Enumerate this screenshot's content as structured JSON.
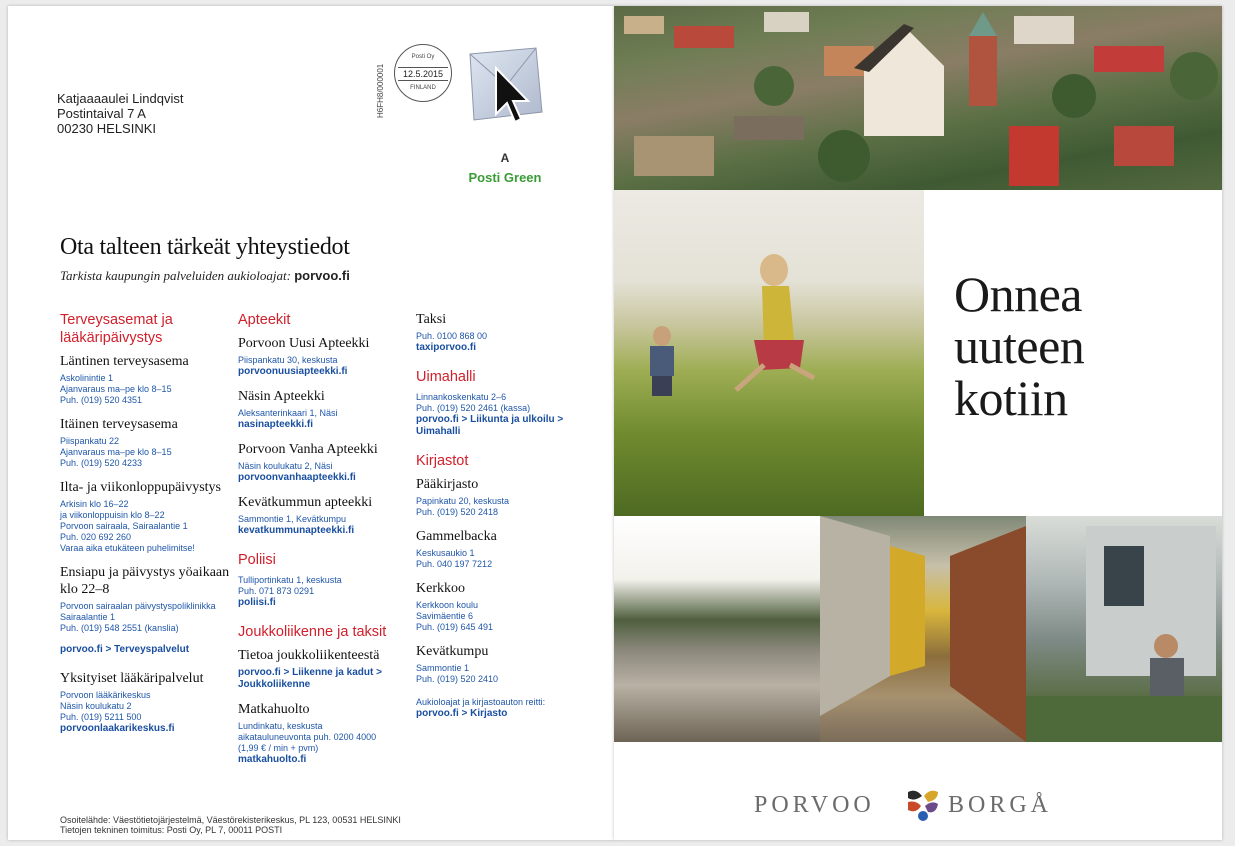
{
  "address": {
    "name": "Katjaaaaulei Lindqvist",
    "street": "Postintaival 7 A",
    "city": "00230 HELSINKI"
  },
  "postage": {
    "code": "H6FH8/000001",
    "postmark_top": "Posti Oy",
    "postmark_date": "12.5.2015",
    "postmark_bottom": "FINLAND",
    "class": "A",
    "service": "Posti Green"
  },
  "heading": {
    "title": "Ota talteen tärkeät yhteystiedot",
    "subtitle_prefix": "Tarkista kaupungin palveluiden aukioloajat:",
    "subtitle_link": "porvoo.fi"
  },
  "col1": {
    "section1": {
      "title": "Terveysasemat ja lääkäripäivystys",
      "entries": [
        {
          "name": "Läntinen terveysasema",
          "lines": [
            "Askolinintie 1",
            "Ajanvaraus ma–pe klo 8–15",
            "Puh. (019) 520 4351"
          ]
        },
        {
          "name": "Itäinen terveysasema",
          "lines": [
            "Piispankatu 22",
            "Ajanvaraus ma–pe klo 8–15",
            "Puh. (019) 520 4233"
          ]
        },
        {
          "name": "Ilta- ja viikonloppupäivystys",
          "lines": [
            "Arkisin klo 16–22",
            "ja viikonloppuisin klo 8–22",
            "Porvoon sairaala, Sairaalantie 1",
            "Puh. 020 692 260",
            "Varaa aika etukäteen puhelimitse!"
          ]
        },
        {
          "name": "Ensiapu ja päivystys yöaikaan klo 22–8",
          "lines": [
            "Porvoon sairaalan päivystyspoliklinikka",
            "Sairaalantie 1",
            "Puh. (019) 548 2551 (kanslia)"
          ]
        }
      ],
      "link": "porvoo.fi > Terveyspalvelut"
    },
    "private": {
      "name": "Yksityiset lääkäripalvelut",
      "lines": [
        "Porvoon lääkärikeskus",
        "Näsin koulukatu 2",
        "Puh. (019) 5211 500"
      ],
      "link": "porvoonlaakarikeskus.fi"
    }
  },
  "col2": {
    "pharmacies": {
      "title": "Apteekit",
      "entries": [
        {
          "name": "Porvoon Uusi Apteekki",
          "lines": [
            "Piispankatu 30, keskusta"
          ],
          "link": "porvoonuusiapteekki.fi"
        },
        {
          "name": "Näsin Apteekki",
          "lines": [
            "Aleksanterinkaari 1, Näsi"
          ],
          "link": "nasinapteekki.fi"
        },
        {
          "name": "Porvoon Vanha Apteekki",
          "lines": [
            "Näsin koulukatu 2, Näsi"
          ],
          "link": "porvoonvanhaapteekki.fi"
        },
        {
          "name": "Kevätkummun apteekki",
          "lines": [
            "Sammontie 1, Kevätkumpu"
          ],
          "link": "kevatkummunapteekki.fi"
        }
      ]
    },
    "police": {
      "title": "Poliisi",
      "lines": [
        "Tulliportinkatu 1, keskusta",
        "Puh. 071 873 0291"
      ],
      "link": "poliisi.fi"
    },
    "transport": {
      "title": "Joukkoliikenne ja taksit",
      "info_name": "Tietoa joukkoliikenteestä",
      "info_link1": "porvoo.fi > Liikenne ja kadut >",
      "info_link2": "Joukkoliikenne",
      "mh_name": "Matkahuolto",
      "mh_lines": [
        "Lundinkatu, keskusta",
        "aikatauluneuvonta puh. 0200 4000",
        "(1,99 € / min + pvm)"
      ],
      "mh_link": "matkahuolto.fi"
    }
  },
  "col3": {
    "taxi": {
      "name": "Taksi",
      "lines": [
        "Puh. 0100 868 00"
      ],
      "link": "taxiporvoo.fi"
    },
    "pool": {
      "title": "Uimahalli",
      "lines": [
        "Linnankoskenkatu 2–6",
        "Puh. (019) 520 2461 (kassa)"
      ],
      "link1": "porvoo.fi > Liikunta ja ulkoilu >",
      "link2": "Uimahalli"
    },
    "libraries": {
      "title": "Kirjastot",
      "entries": [
        {
          "name": "Pääkirjasto",
          "lines": [
            "Papinkatu 20, keskusta",
            "Puh. (019) 520 2418"
          ]
        },
        {
          "name": "Gammelbacka",
          "lines": [
            "Keskusaukio 1",
            "Puh. 040 197 7212"
          ]
        },
        {
          "name": "Kerkkoo",
          "lines": [
            "Kerkkoon koulu",
            "Savimäentie 6",
            "Puh. (019) 645 491"
          ]
        },
        {
          "name": "Kevätkumpu",
          "lines": [
            "Sammontie 1",
            "Puh. (019) 520 2410"
          ]
        }
      ],
      "note": "Aukioloajat ja kirjastoauton reitti:",
      "link": "porvoo.fi > Kirjasto"
    }
  },
  "footer": {
    "line1": "Osoitelähde: Väestötietojärjestelmä, Väestörekisterikeskus, PL 123, 00531 HELSINKI",
    "line2": "Tietojen tekninen toimitus: Posti Oy, PL 7, 00011 POSTI"
  },
  "cover": {
    "greeting": [
      "Onnea",
      "uuteen",
      "kotiin"
    ],
    "brand_left": "PORVOO",
    "brand_right": "BORGÅ"
  },
  "colors": {
    "heading_red": "#d11f2b",
    "info_blue": "#1f56a8",
    "posti_green": "#3a9c35"
  }
}
